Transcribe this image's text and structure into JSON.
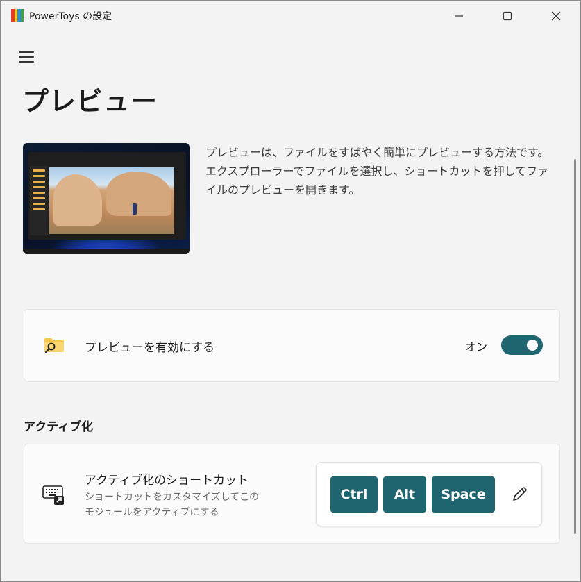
{
  "window": {
    "title": "PowerToys の設定",
    "brand_colors": [
      "#e83a2f",
      "#f8c51c",
      "#2b8fd6",
      "#43a047"
    ]
  },
  "nav": {
    "menu_icon": "hamburger-icon"
  },
  "page": {
    "title": "プレビュー",
    "description": "プレビューは、ファイルをすばやく簡単にプレビューする方法です。エクスプローラーでファイルを選択し、ショートカットを押してファイルのプレビューを開きます。"
  },
  "enable_card": {
    "icon": "folder-search-icon",
    "label": "プレビューを有効にする",
    "toggle_state_label": "オン",
    "enabled": true
  },
  "activation": {
    "section_title": "アクティブ化",
    "shortcut": {
      "icon": "keyboard-shortcut-icon",
      "title": "アクティブ化のショートカット",
      "description": "ショートカットをカスタマイズしてこのモジュールをアクティブにする",
      "keys": [
        "Ctrl",
        "Alt",
        "Space"
      ],
      "edit_icon": "pencil-icon"
    }
  },
  "colors": {
    "accent": "#1e6570",
    "background": "#f3f3f3",
    "card": "#fbfbfb"
  }
}
